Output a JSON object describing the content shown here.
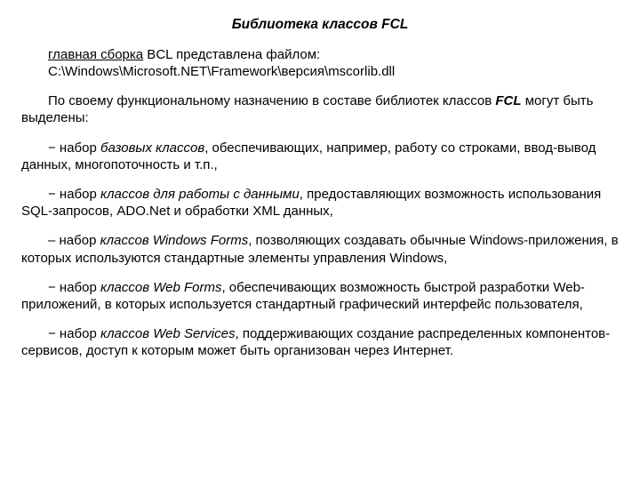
{
  "title": "Библиотека классов FCL",
  "assembly": {
    "label": "главная сборка",
    "line1_rest": " BCL представлена файлом:",
    "path": "C:\\Windows\\Microsoft.NET\\Framework\\версия\\mscorlib.dll"
  },
  "intro": {
    "pre": "По своему функциональному назначению в составе библиотек классов ",
    "fcl": "FCL",
    "post": " могут быть выделены:"
  },
  "items": [
    {
      "dash": "− набор ",
      "em": "базовых классов",
      "rest": ", обеспечивающих, например, работу со строками, ввод-вывод данных, многопоточность и т.п.,"
    },
    {
      "dash": "− набор ",
      "em": "классов для работы с данными",
      "rest": ", предоставляющих возможность использования SQL-запросов, ADO.Net и обработки XML данных,"
    },
    {
      "dash": "– набор ",
      "em": "классов Windows Forms",
      "rest": ", позволяющих создавать обычные Windows-приложения, в которых используются стандартные элементы управления Windows,"
    },
    {
      "dash": "− набор ",
      "em": "классов Web Forms",
      "rest": ", обеспечивающих возможность быстрой разработки Web-приложений, в которых используется стандартный графический интерфейс пользователя,"
    },
    {
      "dash": "− набор ",
      "em": "классов Web Services",
      "rest": ", поддерживающих создание распределенных компонентов-сервисов, доступ к которым может быть организован через Интернет."
    }
  ]
}
